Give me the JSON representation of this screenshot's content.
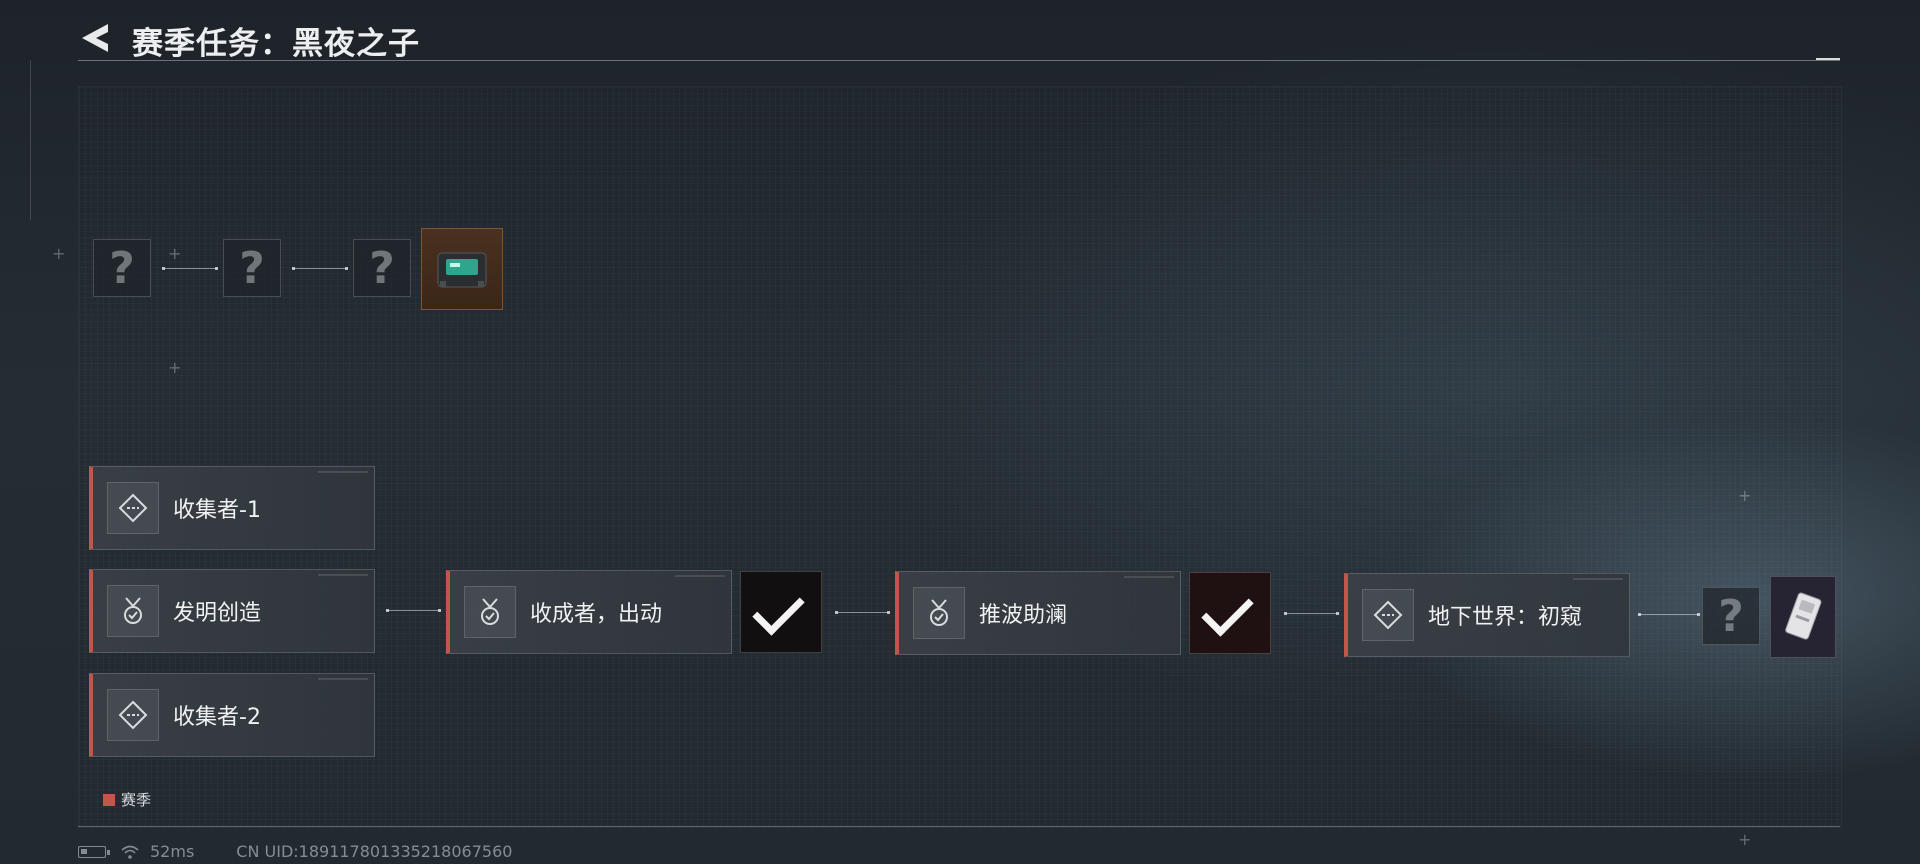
{
  "header": {
    "title": "赛季任务：黑夜之子"
  },
  "top_chain": {
    "nodes": [
      "?",
      "?",
      "?"
    ],
    "reward_icon": "device-item-icon"
  },
  "tasks": {
    "collector1": {
      "label": "收集者-1",
      "icon": "diamond-waypoint-icon"
    },
    "invention": {
      "label": "发明创造",
      "icon": "medal-check-icon"
    },
    "collector2": {
      "label": "收集者-2",
      "icon": "diamond-waypoint-icon"
    },
    "harvester": {
      "label": "收成者，出动",
      "icon": "medal-check-icon"
    },
    "push": {
      "label": "推波助澜",
      "icon": "medal-check-icon"
    },
    "underworld": {
      "label": "地下世界：初窥",
      "icon": "diamond-waypoint-icon"
    }
  },
  "rewards": {
    "harvester_reward": {
      "state": "claimed",
      "icon": "check-icon"
    },
    "push_reward": {
      "state": "claimed",
      "icon": "check-icon"
    },
    "underworld_locked": "?",
    "underworld_reward_icon": "card-item-icon"
  },
  "legend": {
    "label": "赛季",
    "color": "#c3564a"
  },
  "status": {
    "ping": "52ms",
    "uid": "CN UID:18911780133521806756​0"
  }
}
